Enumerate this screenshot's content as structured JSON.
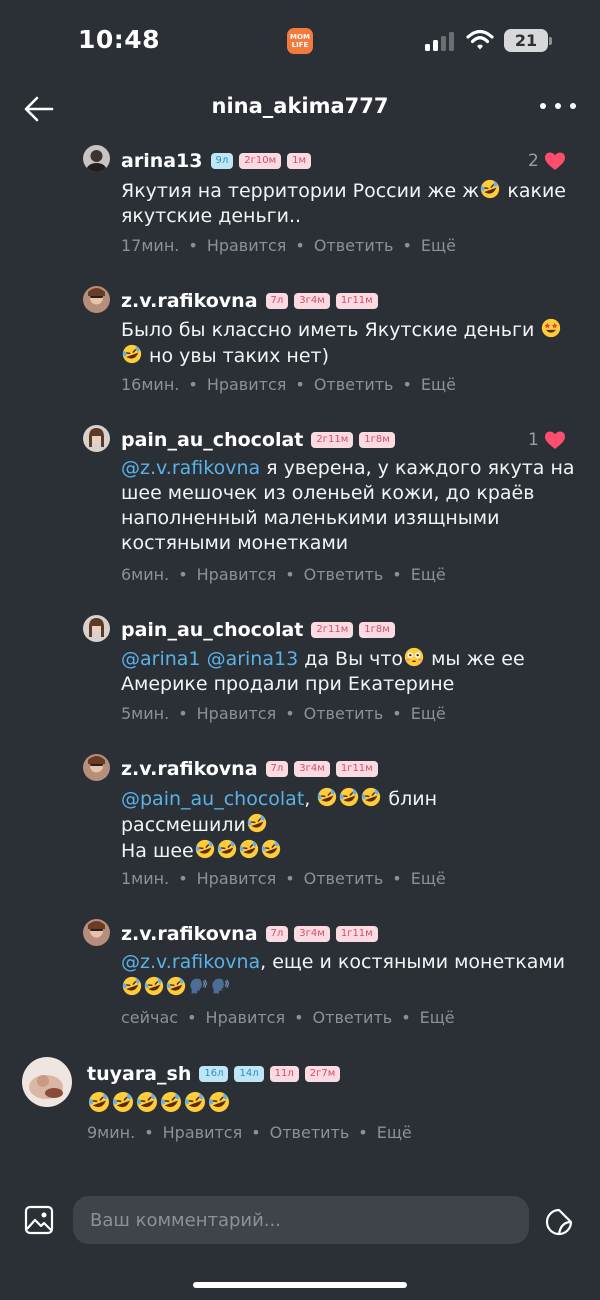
{
  "status": {
    "time": "10:48",
    "app_badge": "MOM LIFE",
    "battery": "21"
  },
  "header": {
    "title": "nina_akima777"
  },
  "comments": [
    {
      "user": "arina13",
      "badges": [
        "9л",
        "2г10м",
        "1м"
      ],
      "likes": "2",
      "body": [
        "Якутия на территории России же ж",
        " какие",
        "якутские деньги.."
      ],
      "time": "17мин."
    },
    {
      "user": "z.v.rafikovna",
      "badges": [
        "7л",
        "3г4м",
        "1г11м"
      ],
      "body": [
        "Было бы классно иметь Якутские деньги",
        " но увы таких нет)"
      ],
      "time": "16мин."
    },
    {
      "user": "pain_au_chocolat",
      "badges": [
        "2г11м",
        "1г8м"
      ],
      "likes": "1",
      "mention": "@z.v.rafikovna",
      "body": [
        " я уверена, у каждого якута на",
        "шее мешочек из оленьей кожи, до краёв",
        "наполненный маленькими изящными",
        "костяными монетками"
      ],
      "time": "6мин."
    },
    {
      "user": "pain_au_chocolat",
      "badges": [
        "2г11м",
        "1г8м"
      ],
      "mentions": [
        "@arina1",
        "@arina13"
      ],
      "body": [
        " да Вы что",
        " мы же ее",
        "Америке продали при Екатерине"
      ],
      "time": "5мин."
    },
    {
      "user": "z.v.rafikovna",
      "badges": [
        "7л",
        "3г4м",
        "1г11м"
      ],
      "mention": "@pain_au_chocolat",
      "body": [
        ",",
        " блин",
        "рассмешили",
        "На шее"
      ],
      "time": "1мин."
    },
    {
      "user": "z.v.rafikovna",
      "badges": [
        "7л",
        "3г4м",
        "1г11м"
      ],
      "mention": "@z.v.rafikovna",
      "body": [
        ", еще и костяными монетками"
      ],
      "time": "сейчас"
    },
    {
      "user": "tuyara_sh",
      "badges": [
        "16л",
        "14л",
        "11л",
        "2г7м"
      ],
      "time": "9мин."
    }
  ],
  "actions": {
    "like": "Нравится",
    "reply": "Ответить",
    "more": "Ещё"
  },
  "composer": {
    "placeholder": "Ваш комментарий..."
  },
  "icons": [
    "back-arrow-icon",
    "more-icon",
    "heart-icon",
    "rofl-emoji",
    "star-struck-emoji",
    "flushed-emoji",
    "speaking-head-emoji",
    "image-icon",
    "sticker-icon"
  ],
  "colors": {
    "background": "#2b2f36",
    "mention": "#5ab2e6",
    "heart": "#ff4d6d",
    "badge_pink": "#fadbe2",
    "badge_blue": "#bfe6f7"
  }
}
